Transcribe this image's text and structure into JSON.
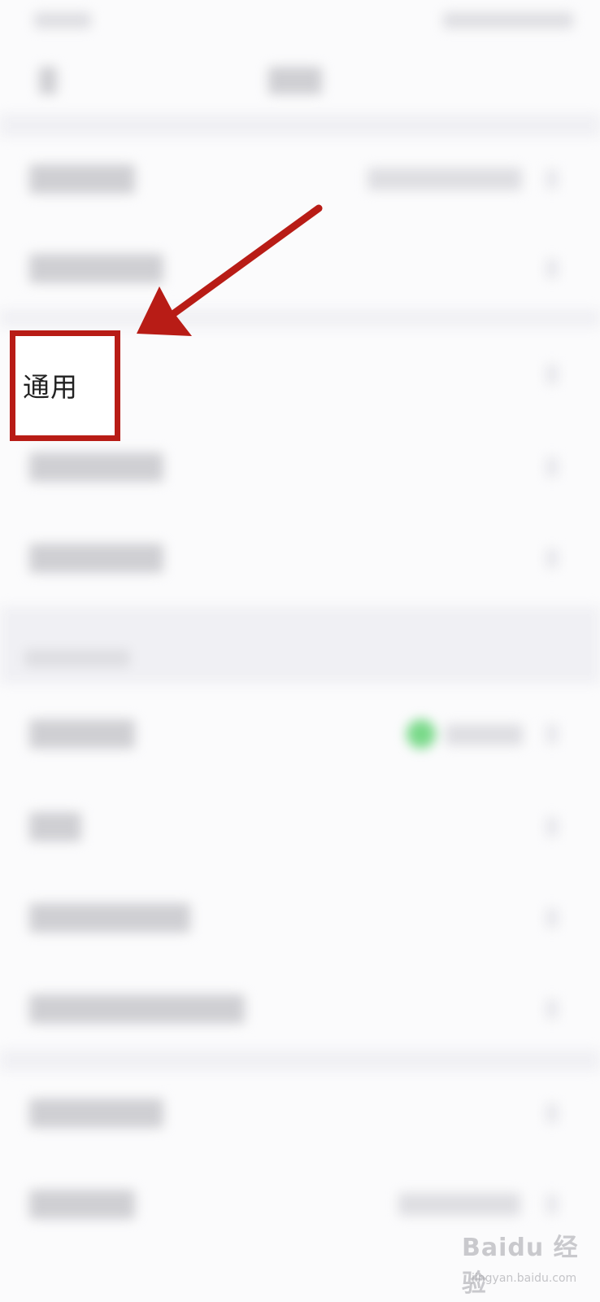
{
  "highlight": {
    "label": "通用"
  },
  "watermark": {
    "brand": "Baidu 经验",
    "domain": "jingyan.baidu.com"
  },
  "colors": {
    "annotation_red": "#b81c16",
    "status_green": "#7ad98a",
    "background": "#fbfbfc"
  }
}
